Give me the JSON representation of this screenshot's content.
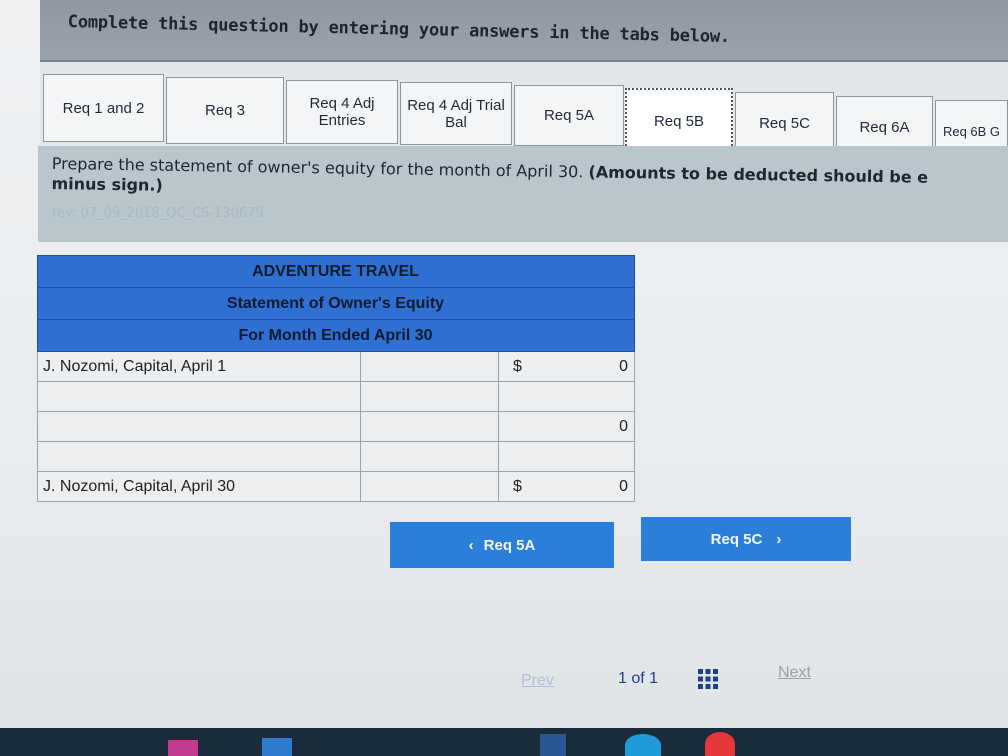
{
  "banner": {
    "text": "Complete this question by entering your answers in the tabs below."
  },
  "tabs": [
    {
      "label": "Req 1 and 2"
    },
    {
      "label": "Req 3"
    },
    {
      "label": "Req 4 Adj Entries"
    },
    {
      "label": "Req 4 Adj Trial Bal"
    },
    {
      "label": "Req 5A"
    },
    {
      "label": "Req 5B"
    },
    {
      "label": "Req 5C"
    },
    {
      "label": "Req 6A"
    },
    {
      "label": "Req 6B G"
    }
  ],
  "prompt": {
    "text_plain": "Prepare the statement of owner's equity for the month of April 30.",
    "text_bold": "(Amounts to be deducted should be e",
    "text_bold2": "minus sign.)",
    "rev": "rev: 07_09_2018_QC_CS-130679"
  },
  "statement": {
    "company": "ADVENTURE TRAVEL",
    "title": "Statement of Owner's Equity",
    "period": "For Month Ended April 30",
    "rows": [
      {
        "label": "J. Nozomi, Capital, April 1",
        "currency": "$",
        "value": "0"
      },
      {
        "label": "",
        "currency": "",
        "value": ""
      },
      {
        "label": "",
        "currency": "",
        "value": "0"
      },
      {
        "label": "",
        "currency": "",
        "value": ""
      },
      {
        "label": "J. Nozomi, Capital, April 30",
        "currency": "$",
        "value": "0"
      }
    ]
  },
  "nav": {
    "prev_label": "Req 5A",
    "next_label": "Req 5C"
  },
  "pager": {
    "prev": "Prev",
    "page": "1",
    "of": "of 1",
    "next": "Next"
  },
  "colors": {
    "header_blue": "#2f6fd1",
    "button_blue": "#2c7fd9",
    "banner_gray": "#9aa2ad"
  }
}
